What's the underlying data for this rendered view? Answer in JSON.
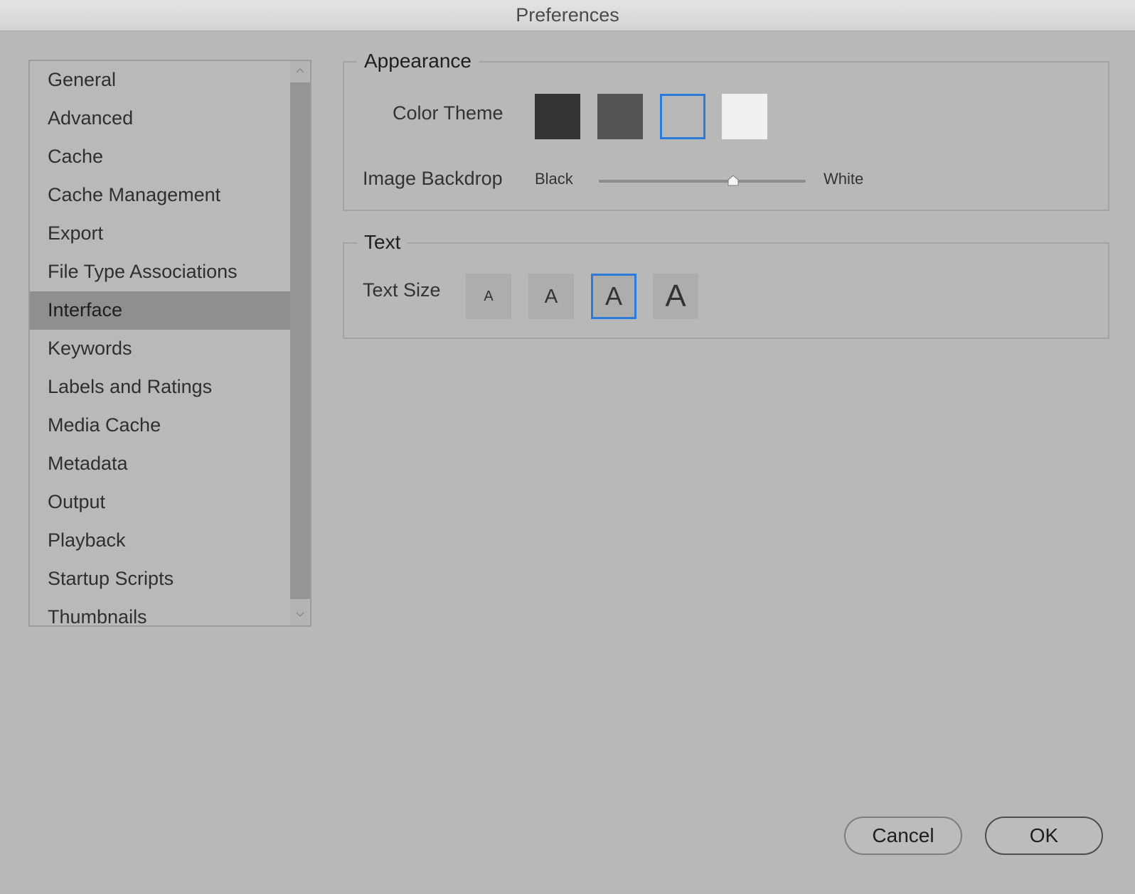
{
  "window": {
    "title": "Preferences"
  },
  "sidebar": {
    "selected_index": 6,
    "items": [
      {
        "label": "General"
      },
      {
        "label": "Advanced"
      },
      {
        "label": "Cache"
      },
      {
        "label": "Cache Management"
      },
      {
        "label": "Export"
      },
      {
        "label": "File Type Associations"
      },
      {
        "label": "Interface"
      },
      {
        "label": "Keywords"
      },
      {
        "label": "Labels and Ratings"
      },
      {
        "label": "Media Cache"
      },
      {
        "label": "Metadata"
      },
      {
        "label": "Output"
      },
      {
        "label": "Playback"
      },
      {
        "label": "Startup Scripts"
      },
      {
        "label": "Thumbnails"
      }
    ],
    "scroll_up_icon": "chevron-up-icon",
    "scroll_down_icon": "chevron-down-icon"
  },
  "appearance": {
    "title": "Appearance",
    "color_theme_label": "Color Theme",
    "themes": [
      {
        "color": "#343434",
        "selected": false
      },
      {
        "color": "#545454",
        "selected": false
      },
      {
        "color": "#b8b8b8",
        "selected": true
      },
      {
        "color": "#f0f0f0",
        "selected": false
      }
    ],
    "image_backdrop_label": "Image Backdrop",
    "backdrop_min_label": "Black",
    "backdrop_max_label": "White",
    "backdrop_value": 0.65
  },
  "text": {
    "title": "Text",
    "text_size_label": "Text Size",
    "sizes": [
      {
        "glyph": "A",
        "selected": false
      },
      {
        "glyph": "A",
        "selected": false
      },
      {
        "glyph": "A",
        "selected": true
      },
      {
        "glyph": "A",
        "selected": false
      }
    ]
  },
  "buttons": {
    "cancel_label": "Cancel",
    "ok_label": "OK"
  },
  "colors": {
    "accent": "#2a7bdc",
    "background": "#b8b8b8",
    "selection": "#8f8f8f"
  }
}
